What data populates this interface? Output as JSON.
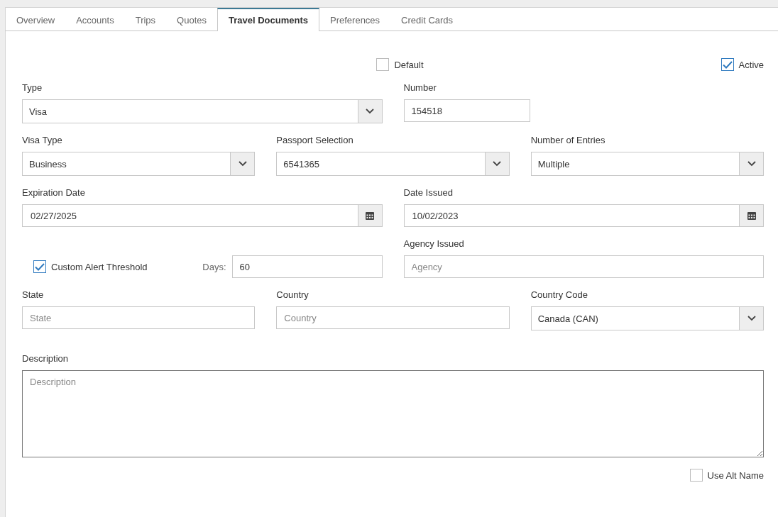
{
  "tabs": [
    {
      "label": "Overview",
      "selected": false
    },
    {
      "label": "Accounts",
      "selected": false
    },
    {
      "label": "Trips",
      "selected": false
    },
    {
      "label": "Quotes",
      "selected": false
    },
    {
      "label": "Travel Documents",
      "selected": true
    },
    {
      "label": "Preferences",
      "selected": false
    },
    {
      "label": "Credit Cards",
      "selected": false
    }
  ],
  "default": {
    "label": "Default",
    "checked": false
  },
  "active": {
    "label": "Active",
    "checked": true
  },
  "type": {
    "label": "Type",
    "kind": "select",
    "value": "Visa"
  },
  "number": {
    "label": "Number",
    "kind": "text",
    "value": "154518"
  },
  "visa_type": {
    "label": "Visa Type",
    "kind": "select",
    "value": "Business"
  },
  "passport_selection": {
    "label": "Passport Selection",
    "kind": "select",
    "value": "6541365"
  },
  "number_of_entries": {
    "label": "Number of Entries",
    "kind": "select",
    "value": "Multiple"
  },
  "expiration_date": {
    "label": "Expiration Date",
    "kind": "date",
    "value": "02/27/2025"
  },
  "date_issued": {
    "label": "Date Issued",
    "kind": "date",
    "value": "10/02/2023"
  },
  "custom_alert_threshold": {
    "label": "Custom Alert Threshold",
    "checked": true
  },
  "days": {
    "label": "Days:",
    "kind": "text",
    "value": "60"
  },
  "agency_issued": {
    "label": "Agency Issued",
    "kind": "text",
    "placeholder": "Agency"
  },
  "state": {
    "label": "State",
    "kind": "text",
    "placeholder": "State"
  },
  "country": {
    "label": "Country",
    "kind": "text",
    "placeholder": "Country"
  },
  "country_code": {
    "label": "Country Code",
    "kind": "select",
    "value": "Canada (CAN)"
  },
  "description": {
    "label": "Description",
    "placeholder": "Description"
  },
  "use_alt_name": {
    "label": "Use Alt Name",
    "checked": false
  }
}
